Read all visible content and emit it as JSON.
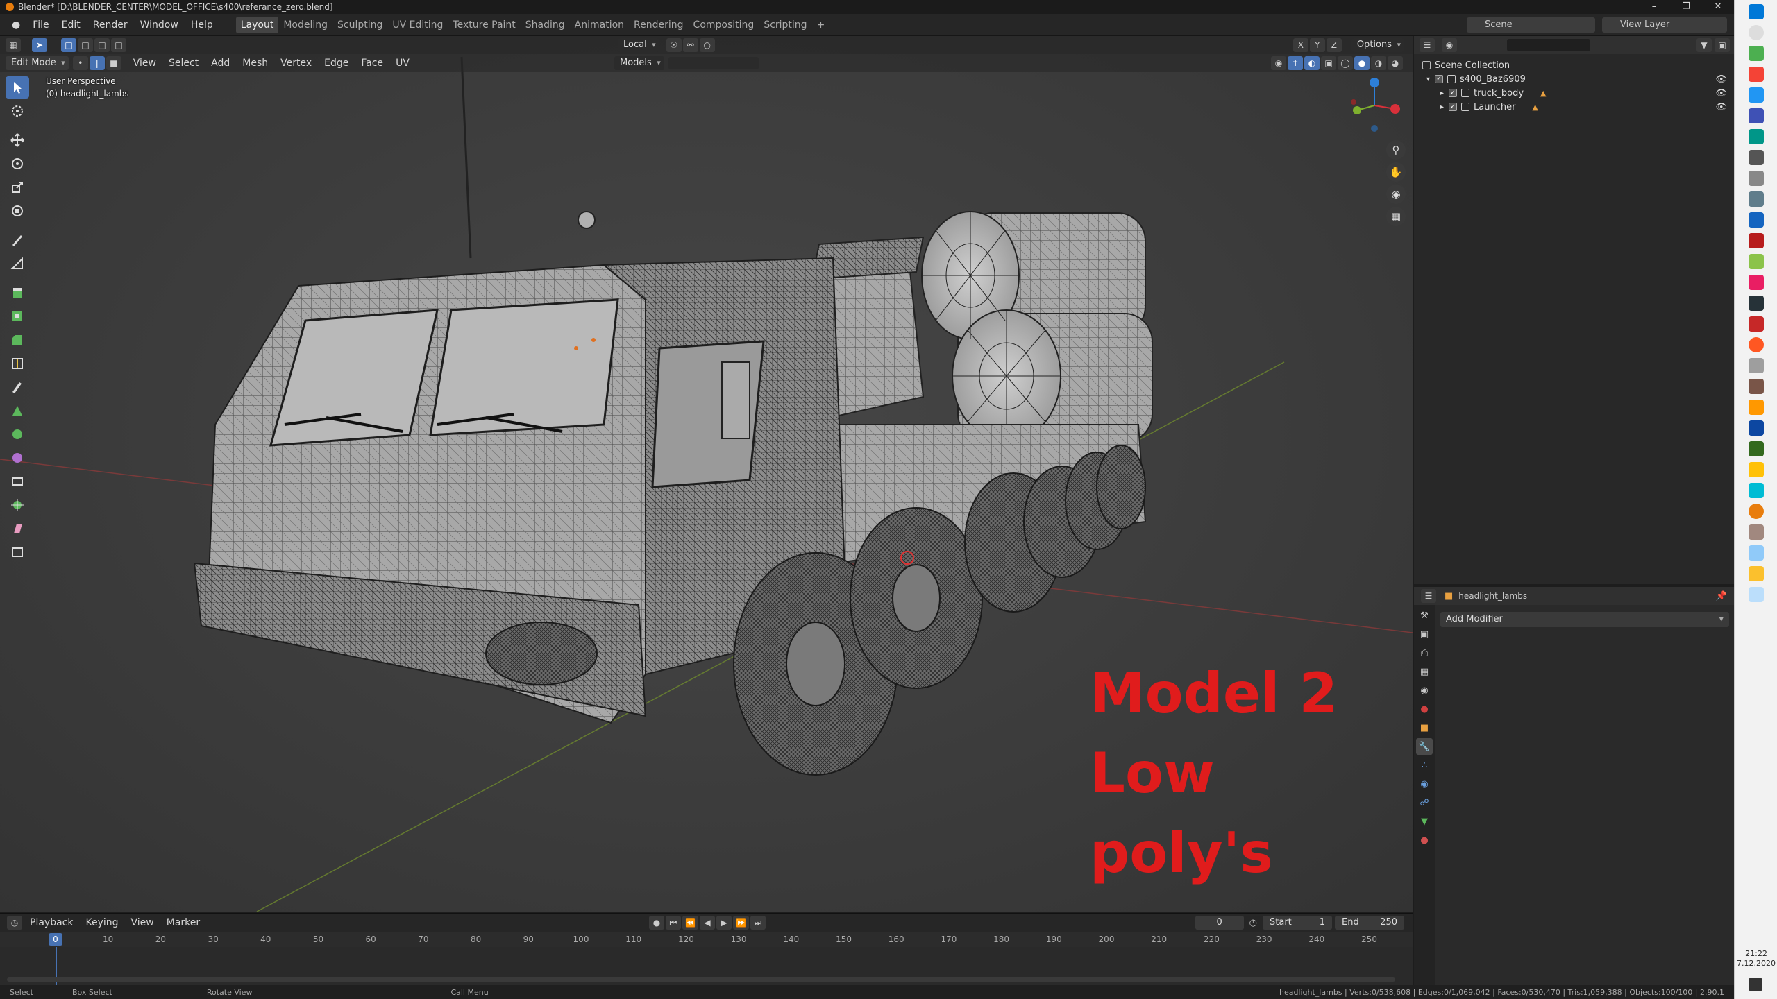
{
  "window": {
    "title": "Blender* [D:\\BLENDER_CENTER\\MODEL_OFFICE\\s400\\referance_zero.blend]"
  },
  "menu": [
    "File",
    "Edit",
    "Render",
    "Window",
    "Help"
  ],
  "workspaces": [
    "Layout",
    "Modeling",
    "Sculpting",
    "UV Editing",
    "Texture Paint",
    "Shading",
    "Animation",
    "Rendering",
    "Compositing",
    "Scripting"
  ],
  "active_workspace": "Layout",
  "scene": {
    "name": "Scene",
    "view_layer": "View Layer"
  },
  "viewport": {
    "transform_orientation": "Local",
    "axis_labels": [
      "X",
      "Y",
      "Z"
    ],
    "options_label": "Options",
    "mode": "Edit Mode",
    "menus": [
      "View",
      "Select",
      "Add",
      "Mesh",
      "Vertex",
      "Edge",
      "Face",
      "UV"
    ],
    "collection_filter": "Models",
    "perspective": "User Perspective",
    "object_label": "(0) headlight_lambs"
  },
  "annotation": {
    "line1": "Model 2",
    "line2": "Low poly's"
  },
  "outliner": {
    "root": "Scene Collection",
    "items": [
      {
        "name": "s400_Baz6909",
        "level": 0
      },
      {
        "name": "truck_body",
        "level": 1
      },
      {
        "name": "Launcher",
        "level": 1
      }
    ]
  },
  "properties": {
    "object_name": "headlight_lambs",
    "add_modifier": "Add Modifier"
  },
  "timeline": {
    "menus": [
      "Playback",
      "Keying",
      "View",
      "Marker"
    ],
    "current_frame": "0",
    "start_label": "Start",
    "start": "1",
    "end_label": "End",
    "end": "250",
    "ticks": [
      "0",
      "10",
      "20",
      "30",
      "40",
      "50",
      "60",
      "70",
      "80",
      "90",
      "100",
      "110",
      "120",
      "130",
      "140",
      "150",
      "160",
      "170",
      "180",
      "190",
      "200",
      "210",
      "220",
      "230",
      "240",
      "250"
    ]
  },
  "statusbar": {
    "select": "Select",
    "box_select": "Box Select",
    "rotate": "Rotate View",
    "call_menu": "Call Menu",
    "stats": "headlight_lambs | Verts:0/538,608 | Edges:0/1,069,042 | Faces:0/530,470 | Tris:1,059,388 | Objects:100/100 | 2.90.1"
  },
  "taskbar": {
    "time": "21:22",
    "date": "7.12.2020"
  },
  "colors": {
    "accent": "#4772b3",
    "annotation": "#e01c1c",
    "orange": "#e87d0d"
  }
}
